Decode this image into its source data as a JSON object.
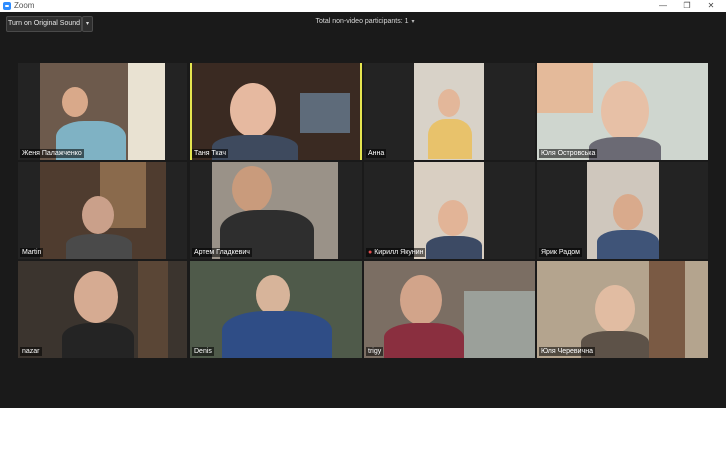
{
  "window": {
    "title": "Zoom",
    "controls": {
      "minimize": "—",
      "restore": "❐",
      "close": "✕"
    }
  },
  "toolbar": {
    "sound_button_label": "Turn on Original Sound",
    "sound_dropdown_glyph": "▾",
    "non_video_label": "Total non-video participants: 1",
    "non_video_caret": "▾"
  },
  "participants": [
    {
      "name": "Женя Палажченко",
      "muted": false,
      "active": false
    },
    {
      "name": "Таня Ткач",
      "muted": false,
      "active": true
    },
    {
      "name": "Анна",
      "muted": false,
      "active": false
    },
    {
      "name": "Юля Островська",
      "muted": false,
      "active": false
    },
    {
      "name": "Martin",
      "muted": false,
      "active": false
    },
    {
      "name": "Артем Гладкевич",
      "muted": false,
      "active": false
    },
    {
      "name": "Кирилл Якунин",
      "muted": true,
      "active": false
    },
    {
      "name": "Ярик Радом",
      "muted": false,
      "active": false
    },
    {
      "name": "nazar",
      "muted": false,
      "active": false
    },
    {
      "name": "Denis",
      "muted": false,
      "active": false
    },
    {
      "name": "trigy",
      "muted": false,
      "active": false
    },
    {
      "name": "Юля Черевична",
      "muted": false,
      "active": false
    }
  ],
  "icons": {
    "mic_muted": "mic-muted-icon",
    "app": "zoom-app-icon"
  },
  "colors": {
    "active_speaker_border": "#e5e54f",
    "stage_bg": "#1a1a1a",
    "zoom_blue": "#2d8cff"
  }
}
